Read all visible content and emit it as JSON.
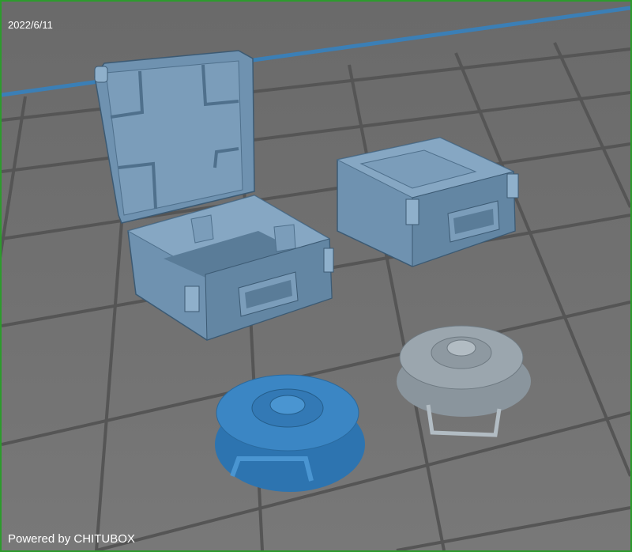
{
  "viewport": {
    "date_stamp": "2022/6/11",
    "watermark": "Powered by CHITUBOX"
  },
  "colors": {
    "frame_border": "#2d9b2d",
    "grid_line": "#555555",
    "build_plate_edge": "#3b7fb6",
    "model_fill": "#6f92b0",
    "model_selected": "#3b86c4",
    "model_unselected": "#9ba6ae"
  },
  "models": [
    {
      "name": "open-ammo-box"
    },
    {
      "name": "closed-ammo-box"
    },
    {
      "name": "round-lid-selected"
    },
    {
      "name": "round-lid-gray"
    }
  ]
}
